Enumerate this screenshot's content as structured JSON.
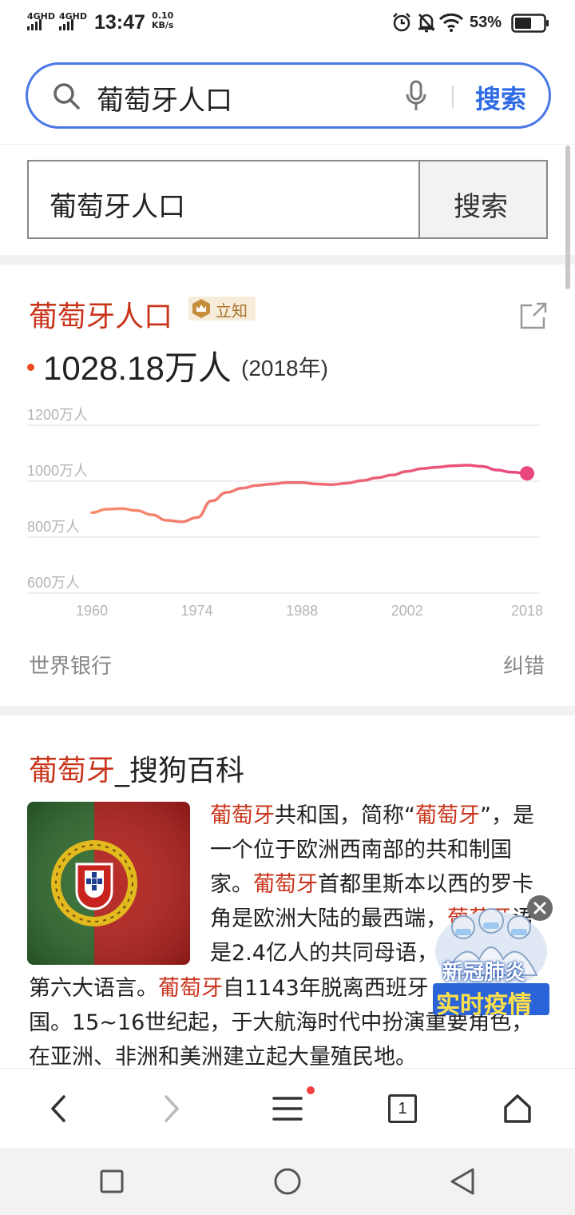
{
  "status_bar": {
    "network1": "4GHD",
    "network2": "4GHD",
    "time": "13:47",
    "speed_value": "0.10",
    "speed_unit": "KB/s",
    "battery": "53%"
  },
  "search": {
    "query": "葡萄牙人口",
    "button": "搜索"
  },
  "page_search": {
    "query": "葡萄牙人口",
    "button": "搜索"
  },
  "card": {
    "title": "葡萄牙人口",
    "badge": "立知",
    "value": "1028.18万人",
    "year": "(2018年)",
    "source": "世界银行",
    "report": "纠错"
  },
  "chart_data": {
    "type": "line",
    "x": [
      1960,
      1962,
      1964,
      1966,
      1968,
      1970,
      1972,
      1974,
      1976,
      1978,
      1980,
      1982,
      1984,
      1986,
      1988,
      1990,
      1992,
      1994,
      1996,
      1998,
      2000,
      2002,
      2004,
      2006,
      2008,
      2010,
      2012,
      2014,
      2016,
      2018
    ],
    "values": [
      888,
      900,
      902,
      895,
      880,
      860,
      855,
      870,
      930,
      960,
      975,
      985,
      990,
      995,
      995,
      990,
      988,
      993,
      1002,
      1012,
      1022,
      1035,
      1045,
      1050,
      1055,
      1057,
      1053,
      1040,
      1032,
      1028
    ],
    "xticks": [
      "1960",
      "1974",
      "1988",
      "2002",
      "2018"
    ],
    "yticks": [
      "1200万人",
      "1000万人",
      "800万人",
      "600万人"
    ],
    "ylim": [
      600,
      1200
    ],
    "xlim": [
      1960,
      2018
    ],
    "line_color_start": "#f58f6a",
    "line_color_end": "#e8467c"
  },
  "baike": {
    "title_red": "葡萄牙",
    "title_rest": "_搜狗百科",
    "lines": [
      [
        {
          "t": "葡萄牙",
          "red": true
        },
        {
          "t": "共和国，简称“"
        },
        {
          "t": "葡萄牙",
          "red": true
        },
        {
          "t": "”，是"
        }
      ],
      [
        {
          "t": "一个位于欧洲西南部的共和制国"
        }
      ],
      [
        {
          "t": "家。"
        },
        {
          "t": "葡萄牙",
          "red": true
        },
        {
          "t": "首都里斯本以西的罗卡"
        }
      ],
      [
        {
          "t": "角是欧洲大陆的最西端，"
        },
        {
          "t": "葡萄牙",
          "red": true
        },
        {
          "t": "语"
        }
      ],
      [
        {
          "t": "是2.4亿人的共同母语，"
        }
      ],
      [
        {
          "t": "第六大语言。"
        },
        {
          "t": "葡萄牙",
          "red": true
        },
        {
          "t": "自1143年脱离西班牙"
        }
      ],
      [
        {
          "t": "国。15~16世纪起，于大航海时代中扮演重要角色，"
        }
      ],
      [
        {
          "t": "在亚洲、非洲和美洲建立起大量殖民地。"
        }
      ]
    ]
  },
  "ad": {
    "line1": "新冠肺炎",
    "line2": "实时疫情"
  },
  "browser_nav": {
    "tabs_count": "1"
  }
}
